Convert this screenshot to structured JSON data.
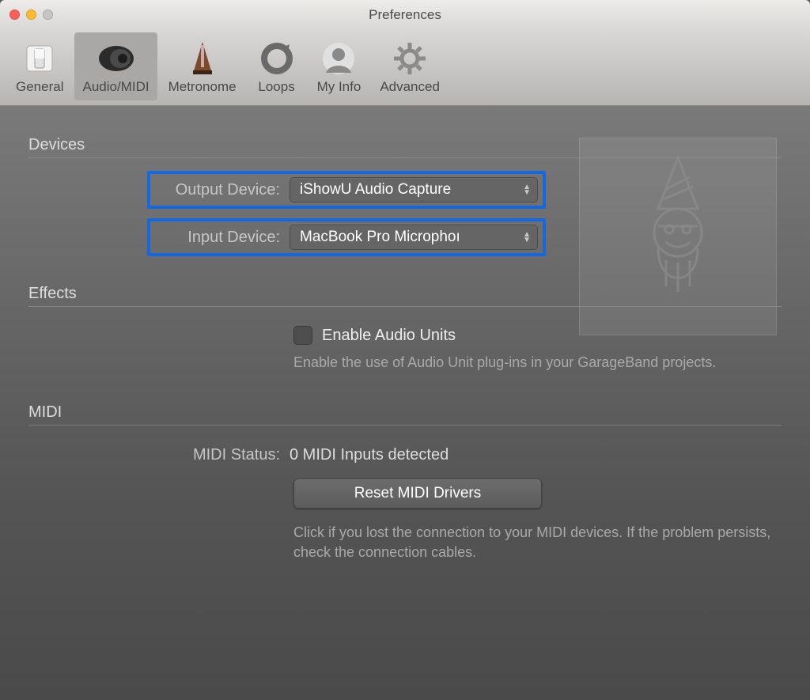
{
  "window": {
    "title": "Preferences"
  },
  "tabs": {
    "general": "General",
    "audiomidi": "Audio/MIDI",
    "metronome": "Metronome",
    "loops": "Loops",
    "myinfo": "My Info",
    "advanced": "Advanced"
  },
  "devices": {
    "heading": "Devices",
    "output_label": "Output Device:",
    "output_value": "iShowU Audio Capture",
    "input_label": "Input Device:",
    "input_value": "MacBook Pro Microphoı"
  },
  "effects": {
    "heading": "Effects",
    "checkbox_label": "Enable Audio Units",
    "help": "Enable the use of Audio Unit plug-ins in your GarageBand projects."
  },
  "midi": {
    "heading": "MIDI",
    "status_label": "MIDI Status:",
    "status_value": "0 MIDI Inputs detected",
    "button": "Reset MIDI Drivers",
    "help": "Click if you lost the connection to your MIDI devices. If the problem persists, check the connection cables."
  }
}
